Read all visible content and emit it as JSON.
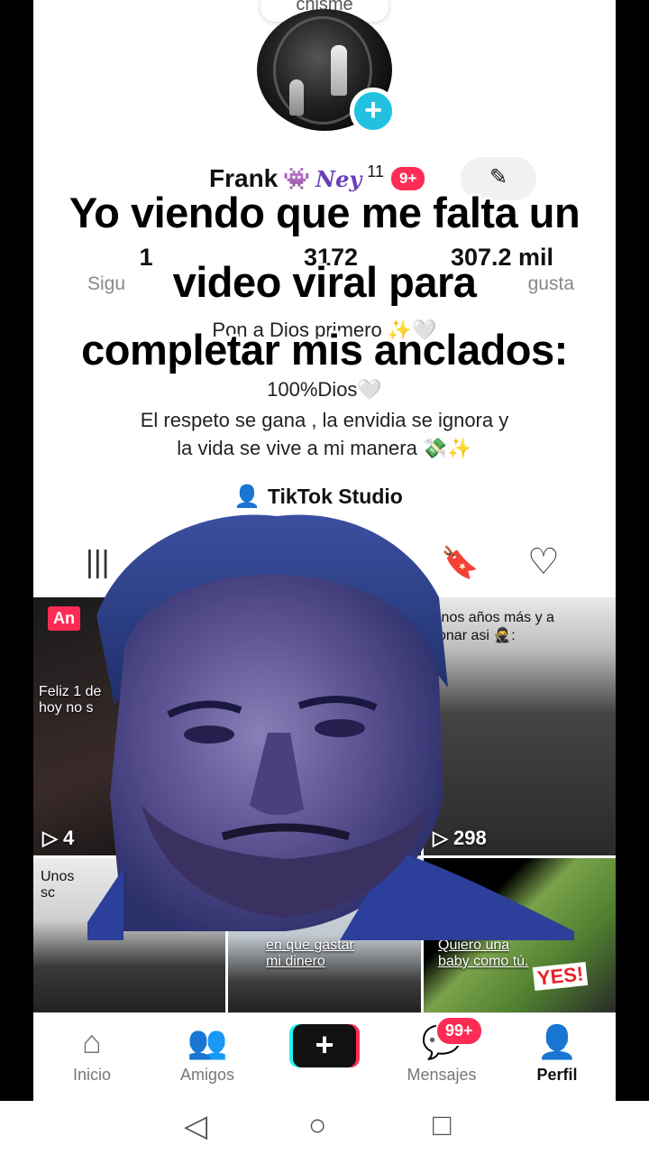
{
  "profile": {
    "note": "chisme",
    "name": "Frank",
    "name_emoji": "👾",
    "name_deco": "Ney",
    "name_superscript": "11",
    "notif_badge": "9+",
    "edit_icon": "✎",
    "stats": [
      {
        "num": "1",
        "label": "Sigu"
      },
      {
        "num": "3172",
        "label": ""
      },
      {
        "num": "307.2 mil",
        "label": "gusta"
      }
    ],
    "bio_lines": [
      "Pon a Dios primero ✨🤍",
      "",
      "100%Dios🤍",
      "El respeto se gana , la envidia se ignora y",
      "la vida se vive a mi manera 💸✨"
    ],
    "studio_label": "TikTok Studio"
  },
  "tabs": [
    "|||",
    "⇅",
    "🔖",
    "♡"
  ],
  "grid": {
    "tiles": [
      {
        "badge": "An",
        "caption": "Feliz 1 de\nhoy no s",
        "views": "4"
      },
      {
        "views": ""
      },
      {
        "caption": "Unos años más y a\nsonar asi 🥷:",
        "views": "298"
      },
      {
        "caption": "Unos\nsc"
      },
      {
        "caption": "en que gastar\nmi dinero"
      },
      {
        "caption": "Quiero una\nbaby como tú.",
        "sticker": "YES!"
      }
    ]
  },
  "meme_text": [
    "Yo viendo que me falta un",
    "video viral para",
    "completar mis anclados:"
  ],
  "nav": {
    "home": "Inicio",
    "friends": "Amigos",
    "create": "+",
    "messages": "Mensajes",
    "messages_badge": "99+",
    "profile": "Perfil"
  },
  "colors": {
    "accent": "#fe2c55",
    "cyan": "#25f4ee",
    "avatar_add": "#22c1e0"
  }
}
